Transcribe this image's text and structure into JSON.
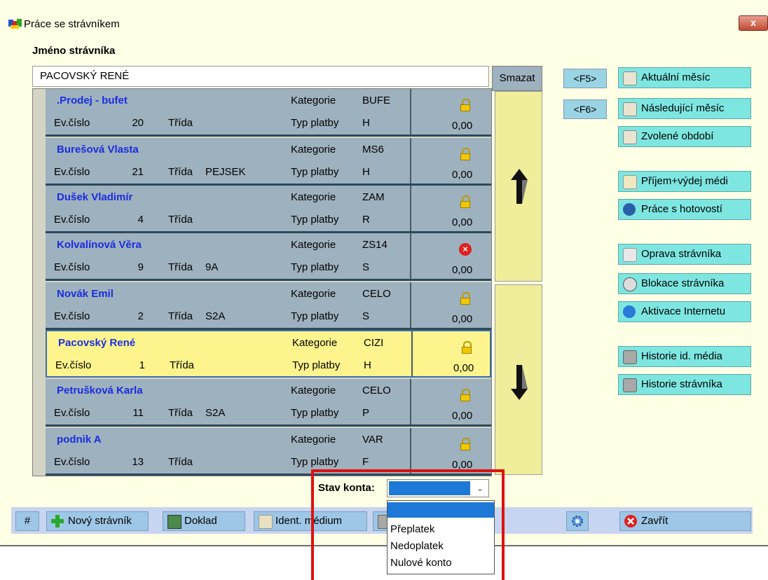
{
  "window": {
    "title": "Práce se strávníkem",
    "close_label": "x"
  },
  "name_label": "Jméno strávníka",
  "name_value": "PACOVSKÝ RENÉ",
  "smazat_label": "Smazat",
  "rows": [
    {
      "name": ".Prodej - bufet",
      "ev_label": "Ev.číslo",
      "ev": "20",
      "trida_label": "Třída",
      "trida": "",
      "kat_label": "Kategorie",
      "kat": "BUFE",
      "typ_label": "Typ platby",
      "typ": "H",
      "amount": "0,00",
      "status_icon": "lock-icon"
    },
    {
      "name": "Burešová Vlasta",
      "ev_label": "Ev.číslo",
      "ev": "21",
      "trida_label": "Třída",
      "trida": "PEJSEK",
      "kat_label": "Kategorie",
      "kat": "MS6",
      "typ_label": "Typ platby",
      "typ": "H",
      "amount": "0,00",
      "status_icon": "lock-icon"
    },
    {
      "name": "Dušek Vladimír",
      "ev_label": "Ev.číslo",
      "ev": "4",
      "trida_label": "Třída",
      "trida": "",
      "kat_label": "Kategorie",
      "kat": "ZAM",
      "typ_label": "Typ platby",
      "typ": "R",
      "amount": "0,00",
      "status_icon": "lock-icon"
    },
    {
      "name": "Kolvalínová Věra",
      "ev_label": "Ev.číslo",
      "ev": "9",
      "trida_label": "Třída",
      "trida": "9A",
      "kat_label": "Kategorie",
      "kat": "ZS14",
      "typ_label": "Typ platby",
      "typ": "S",
      "amount": "0,00",
      "status_icon": "blocked-icon"
    },
    {
      "name": "Novák Emil",
      "ev_label": "Ev.číslo",
      "ev": "2",
      "trida_label": "Třída",
      "trida": "S2A",
      "kat_label": "Kategorie",
      "kat": "CELO",
      "typ_label": "Typ platby",
      "typ": "S",
      "amount": "0,00",
      "status_icon": "lock-icon"
    },
    {
      "name": "Pacovský René",
      "ev_label": "Ev.číslo",
      "ev": "1",
      "trida_label": "Třída",
      "trida": "",
      "kat_label": "Kategorie",
      "kat": "CIZI",
      "typ_label": "Typ platby",
      "typ": "H",
      "amount": "0,00",
      "status_icon": "lock-icon",
      "selected": true
    },
    {
      "name": "Petrušková Karla",
      "ev_label": "Ev.číslo",
      "ev": "11",
      "trida_label": "Třída",
      "trida": "S2A",
      "kat_label": "Kategorie",
      "kat": "CELO",
      "typ_label": "Typ platby",
      "typ": "P",
      "amount": "0,00",
      "status_icon": "lock-icon"
    },
    {
      "name": "podnik A",
      "ev_label": "Ev.číslo",
      "ev": "13",
      "trida_label": "Třída",
      "trida": "",
      "kat_label": "Kategorie",
      "kat": "VAR",
      "typ_label": "Typ platby",
      "typ": "F",
      "amount": "0,00",
      "status_icon": "lock-icon"
    }
  ],
  "fkeys": {
    "f5": "<F5>",
    "f6": "<F6>"
  },
  "right_buttons": {
    "aktualni": "Aktuální měsíc",
    "nasledujici": "Následující měsíc",
    "zvolene": "Zvolené období",
    "prijem": "Příjem+výdej médi",
    "hotovost": "Práce s hotovostí",
    "oprava": "Oprava strávníka",
    "blokace": "Blokace strávníka",
    "aktivace": "Aktivace Internetu",
    "historie_media": "Historie id. média",
    "historie_stravnika": "Historie strávníka"
  },
  "bottom": {
    "hash": "#",
    "novy": "Nový strávník",
    "doklad": "Doklad",
    "ident": "Ident. médium",
    "zavrit": "Zavřít"
  },
  "stav_konta": {
    "label": "Stav konta:",
    "selected": "",
    "options": [
      "",
      "Přeplatek",
      "Nedoplatek",
      "Nulové konto"
    ]
  },
  "colors": {
    "row": "#9eb1be",
    "selected_row": "#fdf48e",
    "name_text": "#1a2de0",
    "highlight": "#e01010"
  }
}
